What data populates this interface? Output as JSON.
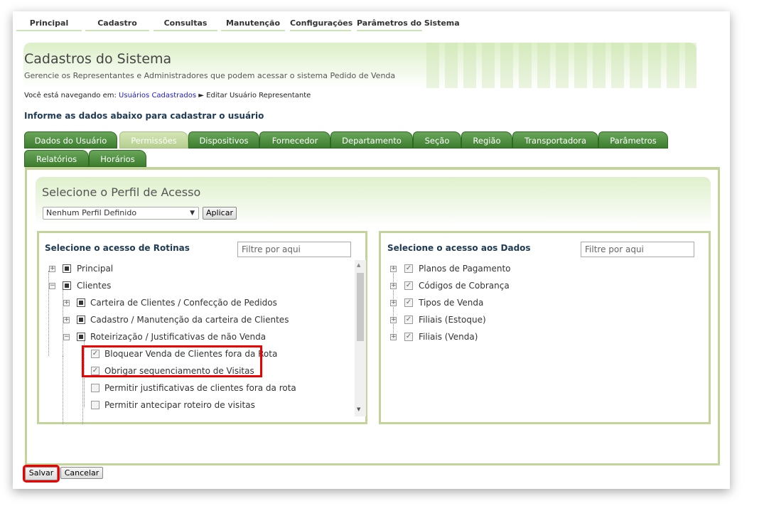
{
  "topnav": [
    "Principal",
    "Cadastro",
    "Consultas",
    "Manutenção",
    "Configurações",
    "Parâmetros do Sistema"
  ],
  "header": {
    "title": "Cadastros do Sistema",
    "subtitle": "Gerencie os Representantes e Administradores que podem acessar o sistema Pedido de Venda"
  },
  "breadcrumb": {
    "prefix": "Você está navegando em:",
    "link": "Usuários Cadastrados",
    "sep": "►",
    "current": "Editar Usuário Representante"
  },
  "form_heading": "Informe as dados abaixo para cadastrar o usuário",
  "tabs_row1": [
    "Dados do Usuário",
    "Permissões",
    "Dispositivos",
    "Fornecedor",
    "Departamento",
    "Seção",
    "Região",
    "Transportadora",
    "Parâmetros"
  ],
  "tabs_row2": [
    "Relatórios",
    "Horários"
  ],
  "active_tab": "Permissões",
  "perfil": {
    "title": "Selecione o Perfil de Acesso",
    "selected": "Nenhum Perfil Definido",
    "apply": "Aplicar"
  },
  "rotinas": {
    "title": "Selecione o acesso de Rotinas",
    "filter_placeholder": "Filtre por aqui",
    "items": [
      {
        "label": "Principal",
        "level": 0,
        "expander": "+",
        "state": "partial"
      },
      {
        "label": "Clientes",
        "level": 0,
        "expander": "-",
        "state": "partial"
      },
      {
        "label": "Carteira de Clientes / Confecção de Pedidos",
        "level": 1,
        "expander": "+",
        "state": "partial"
      },
      {
        "label": "Cadastro / Manutenção da carteira de Clientes",
        "level": 1,
        "expander": "+",
        "state": "partial"
      },
      {
        "label": "Roteirização / Justificativas de não Venda",
        "level": 1,
        "expander": "-",
        "state": "partial"
      },
      {
        "label": "Bloquear Venda de Clientes fora da Rota",
        "level": 2,
        "state": "checked"
      },
      {
        "label": "Obrigar sequenciamento de Visitas",
        "level": 2,
        "state": "checked"
      },
      {
        "label": "Permitir justificativas de clientes fora da rota",
        "level": 2,
        "state": "unchecked"
      },
      {
        "label": "Permitir antecipar roteiro de visitas",
        "level": 2,
        "state": "unchecked"
      }
    ]
  },
  "dados": {
    "title": "Selecione o acesso aos Dados",
    "filter_placeholder": "Filtre por aqui",
    "items": [
      {
        "label": "Planos de Pagamento",
        "state": "checked"
      },
      {
        "label": "Códigos de Cobrança",
        "state": "checked"
      },
      {
        "label": "Tipos de Venda",
        "state": "checked"
      },
      {
        "label": "Filiais (Estoque)",
        "state": "checked"
      },
      {
        "label": "Filiais (Venda)",
        "state": "checked"
      }
    ]
  },
  "actions": {
    "save": "Salvar",
    "cancel": "Cancelar"
  }
}
